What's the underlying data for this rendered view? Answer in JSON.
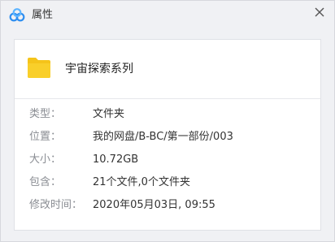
{
  "window": {
    "title": "属性"
  },
  "icons": {
    "app": "baidu-netdisk-cloud-icon",
    "close": "close-icon",
    "folder": "folder-icon"
  },
  "colors": {
    "folder": "#f5c41a",
    "app_blue": "#2e8ef0",
    "app_light": "#5cb4ff"
  },
  "item": {
    "name": "宇宙探索系列"
  },
  "properties": [
    {
      "label": "类型：",
      "value": "文件夹"
    },
    {
      "label": "位置：",
      "value": "我的网盘/B-BC/第一部份/003"
    },
    {
      "label": "大小：",
      "value": "10.72GB"
    },
    {
      "label": "包含：",
      "value": "21个文件,0个文件夹"
    },
    {
      "label": "修改时间：",
      "value": "2020年05月03日, 09:55"
    }
  ]
}
